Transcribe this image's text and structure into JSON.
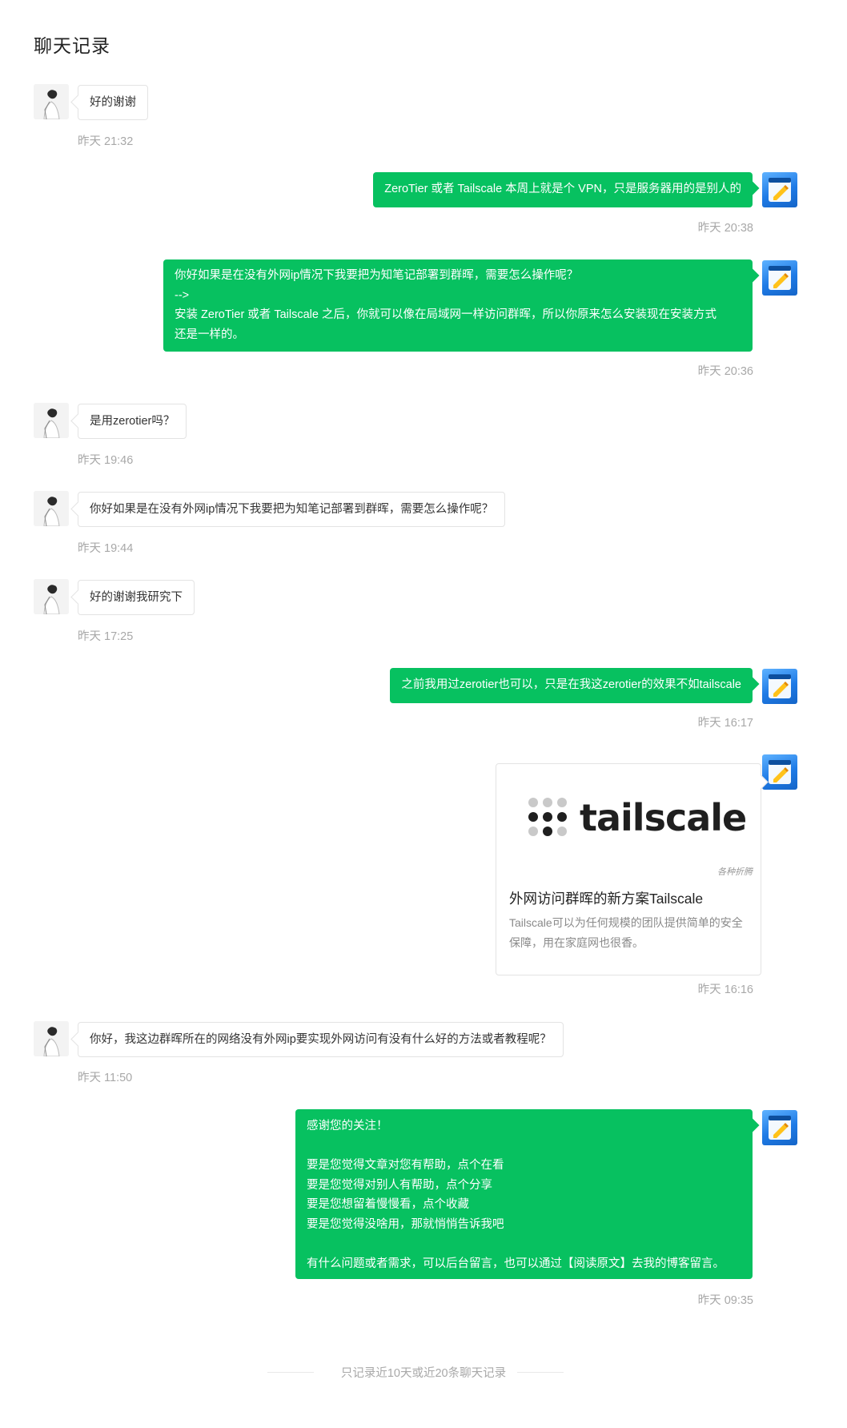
{
  "page": {
    "title": "聊天记录"
  },
  "messages": [
    {
      "side": "left",
      "text": "好的谢谢",
      "time": "昨天 21:32"
    },
    {
      "side": "right",
      "text": "ZeroTier 或者 Tailscale 本周上就是个 VPN，只是服务器用的是别人的",
      "time": "昨天 20:38"
    },
    {
      "side": "right",
      "text": "你好如果是在没有外网ip情况下我要把为知笔记部署到群晖，需要怎么操作呢？\n-->\n安装 ZeroTier 或者 Tailscale 之后，你就可以像在局域网一样访问群晖，所以你原来怎么安装现在安装方式\n还是一样的。",
      "time": "昨天 20:36"
    },
    {
      "side": "left",
      "text": "是用zerotier吗？",
      "time": "昨天 19:46"
    },
    {
      "side": "left",
      "text": "你好如果是在没有外网ip情况下我要把为知笔记部署到群晖，需要怎么操作呢？",
      "time": "昨天 19:44"
    },
    {
      "side": "left",
      "text": "好的谢谢我研究下",
      "time": "昨天 17:25"
    },
    {
      "side": "right",
      "text": "之前我用过zerotier也可以，只是在我这zerotier的效果不如tailscale",
      "time": "昨天 16:17"
    },
    {
      "side": "left",
      "text": "你好，我这边群晖所在的网络没有外网ip要实现外网访问有没有什么好的方法或者教程呢？",
      "time": "昨天 11:50"
    },
    {
      "side": "right",
      "text": "感谢您的关注！\n\n要是您觉得文章对您有帮助，点个在看\n要是您觉得对别人有帮助，点个分享\n要是您想留着慢慢看，点个收藏\n要是您觉得没啥用，那就悄悄告诉我吧\n\n有什么问题或者需求，可以后台留言，也可以通过【阅读原文】去我的博客留言。",
      "time": "昨天 09:35"
    }
  ],
  "card": {
    "logo_text": "tailscale",
    "source": "各种折腾",
    "title": "外网访问群晖的新方案Tailscale",
    "desc": "Tailscale可以为任何规模的团队提供简单的安全保障，用在家庭网也很香。",
    "time": "昨天 16:16"
  },
  "footer": {
    "text": "只记录近10天或近20条聊天记录"
  },
  "icons": {
    "user_avatar": "person-avatar-icon",
    "bot_avatar": "notepad-pen-icon"
  },
  "colors": {
    "accent_green": "#07c160",
    "muted_text": "#a8a8a8"
  }
}
